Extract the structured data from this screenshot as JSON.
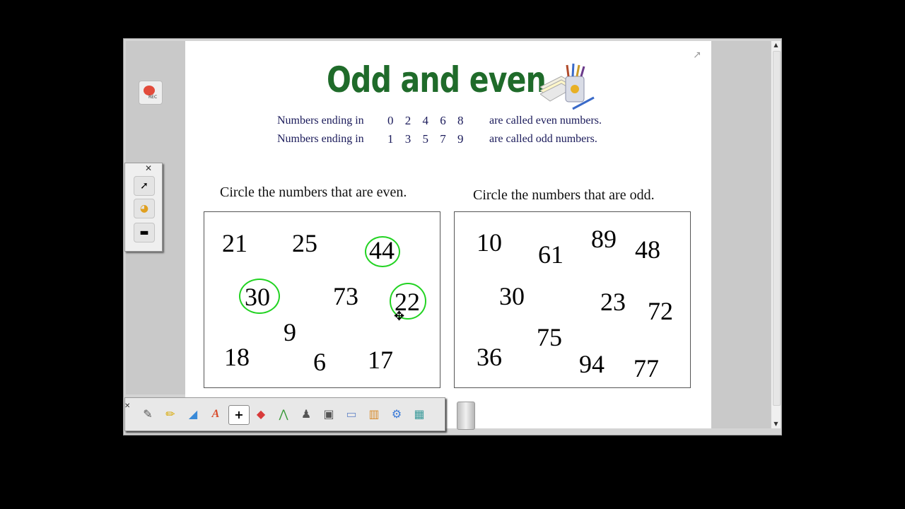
{
  "title": "Odd and even",
  "rules": [
    {
      "prefix": "Numbers ending in",
      "digits": "0 2 4 6 8",
      "suffix": "are called even numbers."
    },
    {
      "prefix": "Numbers ending in",
      "digits": "1 3 5 7 9",
      "suffix": "are called odd numbers."
    }
  ],
  "even_panel": {
    "heading": "Circle the numbers that are even.",
    "numbers": [
      "21",
      "25",
      "44",
      "30",
      "73",
      "22",
      "9",
      "18",
      "6",
      "17"
    ],
    "circled": [
      "44",
      "30",
      "22"
    ]
  },
  "odd_panel": {
    "heading": "Circle the numbers that are odd.",
    "numbers": [
      "10",
      "61",
      "89",
      "48",
      "30",
      "23",
      "72",
      "75",
      "36",
      "94",
      "77"
    ]
  },
  "recorder": {
    "label": "REC"
  },
  "side_toolbar": {
    "close": "✕",
    "items": [
      "select-tool",
      "palette-tool",
      "screen-shade-tool"
    ]
  },
  "bottom_toolbar": {
    "close": "✕",
    "tools": [
      "pen",
      "highlighter",
      "eraser",
      "text",
      "move",
      "shapes",
      "lines",
      "gallery",
      "camera",
      "screen-capture",
      "chart",
      "properties",
      "table"
    ]
  },
  "colors": {
    "title": "#1f6b2a",
    "rule_text": "#1a1a5a",
    "circle": "#22d322"
  }
}
